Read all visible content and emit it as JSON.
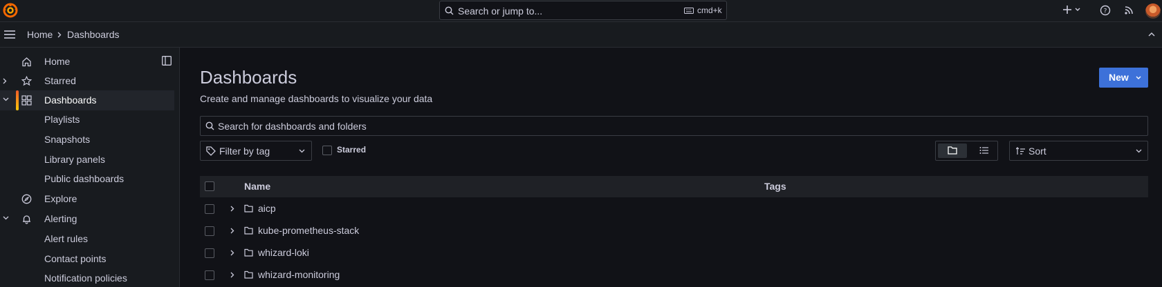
{
  "topbar": {
    "search_placeholder": "Search or jump to...",
    "shortcut": "cmd+k"
  },
  "breadcrumb": {
    "home": "Home",
    "current": "Dashboards"
  },
  "sidebar": {
    "items": [
      {
        "label": "Home",
        "icon": "home-icon"
      },
      {
        "label": "Starred",
        "icon": "star-icon"
      },
      {
        "label": "Dashboards",
        "icon": "dashboards-grid-icon",
        "active": true
      },
      {
        "label": "Playlists"
      },
      {
        "label": "Snapshots"
      },
      {
        "label": "Library panels"
      },
      {
        "label": "Public dashboards"
      },
      {
        "label": "Explore",
        "icon": "compass-icon"
      },
      {
        "label": "Alerting",
        "icon": "bell-icon"
      },
      {
        "label": "Alert rules"
      },
      {
        "label": "Contact points"
      },
      {
        "label": "Notification policies"
      }
    ]
  },
  "main": {
    "title": "Dashboards",
    "subtitle": "Create and manage dashboards to visualize your data",
    "new_button": "New",
    "search_placeholder": "Search for dashboards and folders",
    "tag_filter_placeholder": "Filter by tag",
    "starred_label": "Starred",
    "sort_label": "Sort",
    "table": {
      "columns": [
        "Name",
        "Tags"
      ],
      "rows": [
        {
          "name": "aicp"
        },
        {
          "name": "kube-prometheus-stack"
        },
        {
          "name": "whizard-loki"
        },
        {
          "name": "whizard-monitoring"
        }
      ]
    }
  },
  "colors": {
    "accent": "#3d71d9",
    "active_bar_start": "#f05a28",
    "active_bar_end": "#fbca0a",
    "background": "#111217",
    "panel": "#181b1f"
  }
}
